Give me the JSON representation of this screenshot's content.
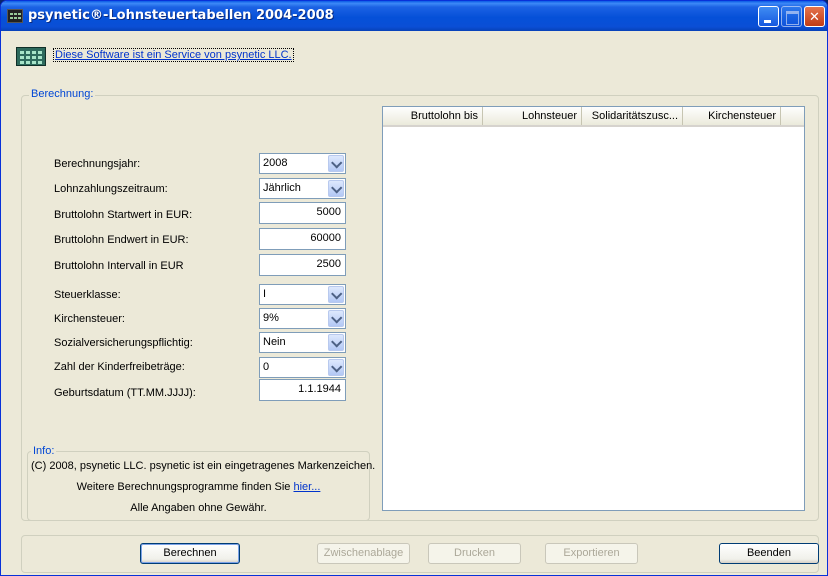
{
  "window": {
    "title": "psynetic®-Lohnsteuertabellen 2004-2008"
  },
  "service_link": "Diese Software ist ein Service von psynetic LLC.",
  "berechnung": {
    "title": "Berechnung:",
    "fields": [
      {
        "label": "Berechnungsjahr:",
        "type": "combo",
        "value": "2008"
      },
      {
        "label": "Lohnzahlungszeitraum:",
        "type": "combo",
        "value": "Jährlich"
      },
      {
        "label": "Bruttolohn Startwert in EUR:",
        "type": "text",
        "value": "5000"
      },
      {
        "label": "Bruttolohn Endwert in EUR:",
        "type": "text",
        "value": "60000"
      },
      {
        "label": "Bruttolohn Intervall in EUR",
        "type": "text",
        "value": "2500"
      },
      {
        "label": "Steuerklasse:",
        "type": "combo",
        "value": "I"
      },
      {
        "label": "Kirchensteuer:",
        "type": "combo",
        "value": "9%"
      },
      {
        "label": "Sozialversicherungspflichtig:",
        "type": "combo",
        "value": "Nein"
      },
      {
        "label": "Zahl der Kinderfreibeträge:",
        "type": "combo",
        "value": "0"
      },
      {
        "label": "Geburtsdatum (TT.MM.JJJJ):",
        "type": "text",
        "value": "1.1.1944"
      }
    ]
  },
  "table": {
    "columns": [
      "Bruttolohn bis",
      "Lohnsteuer",
      "Solidaritätszusc...",
      "Kirchensteuer"
    ],
    "rows": []
  },
  "info": {
    "title": "Info:",
    "line1": "(C) 2008, psynetic LLC. psynetic ist ein eingetragenes Markenzeichen.",
    "line2_prefix": "Weitere Berechnungsprogramme finden Sie",
    "line2_link": "hier...",
    "line3": "Alle Angaben ohne Gewähr."
  },
  "buttons": {
    "berechnen": "Berechnen",
    "zwischenablage": "Zwischenablage",
    "drucken": "Drucken",
    "exportieren": "Exportieren",
    "beenden": "Beenden"
  }
}
